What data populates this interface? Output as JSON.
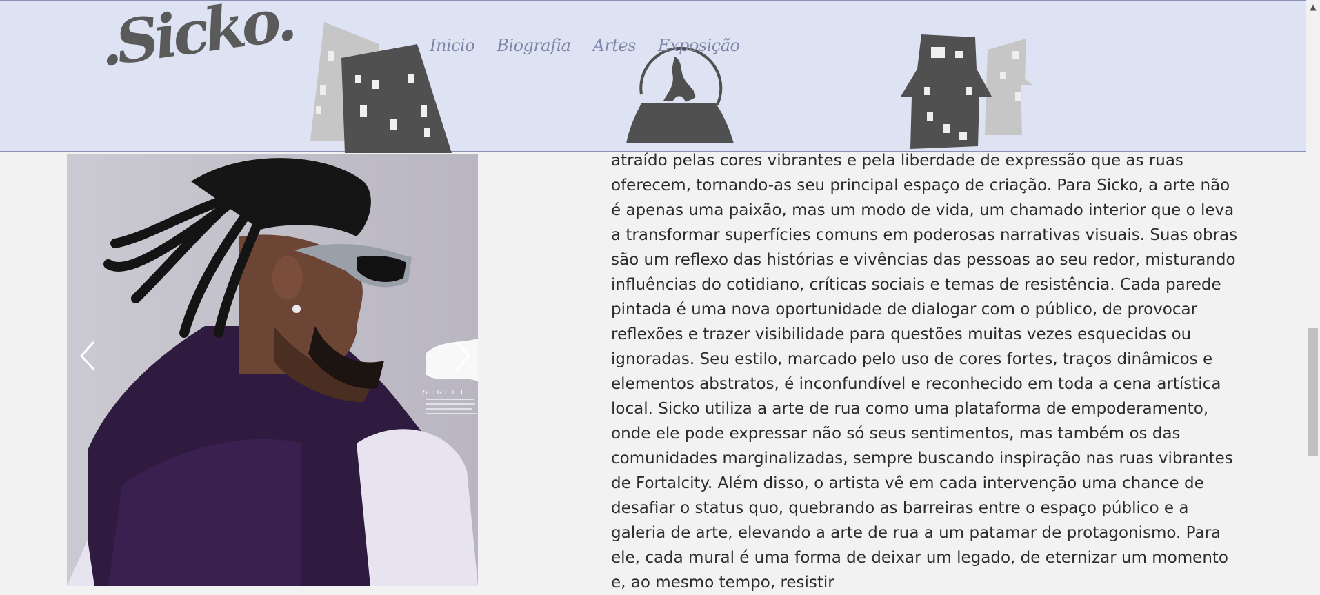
{
  "header": {
    "logo_text": ".Sicko.",
    "nav": [
      {
        "label": "Inicio"
      },
      {
        "label": "Biografia"
      },
      {
        "label": "Artes"
      },
      {
        "label": "Exposição"
      }
    ]
  },
  "carousel": {
    "prev_icon": "chevron-left-icon",
    "next_icon": "chevron-right-icon",
    "poster_label": "STREET"
  },
  "bio": {
    "text": "atraído pelas cores vibrantes e pela liberdade de expressão que as ruas oferecem, tornando-as seu principal espaço de criação. Para Sicko, a arte não é apenas uma paixão, mas um modo de vida, um chamado interior que o leva a transformar superfícies comuns em poderosas narrativas visuais. Suas obras são um reflexo das histórias e vivências das pessoas ao seu redor, misturando influências do cotidiano, críticas sociais e temas de resistência. Cada parede pintada é uma nova oportunidade de dialogar com o público, de provocar reflexões e trazer visibilidade para questões muitas vezes esquecidas ou ignoradas. Seu estilo, marcado pelo uso de cores fortes, traços dinâmicos e elementos abstratos, é inconfundível e reconhecido em toda a cena artística local. Sicko utiliza a arte de rua como uma plataforma de empoderamento, onde ele pode expressar não só seus sentimentos, mas também os das comunidades marginalizadas, sempre buscando inspiração nas ruas vibrantes de Fortalcity. Além disso, o artista vê em cada intervenção uma chance de desafiar o status quo, quebrando as barreiras entre o espaço público e a galeria de arte, elevando a arte de rua a um patamar de protagonismo. Para ele, cada mural é uma forma de deixar um legado, de eternizar um momento e, ao mesmo tempo, resistir"
  },
  "colors": {
    "header_bg": "#dde3f2",
    "header_border": "#8a91b5",
    "nav_text": "#7f86a8",
    "body_bg": "#f2f2f2",
    "text": "#2c2c2c"
  }
}
